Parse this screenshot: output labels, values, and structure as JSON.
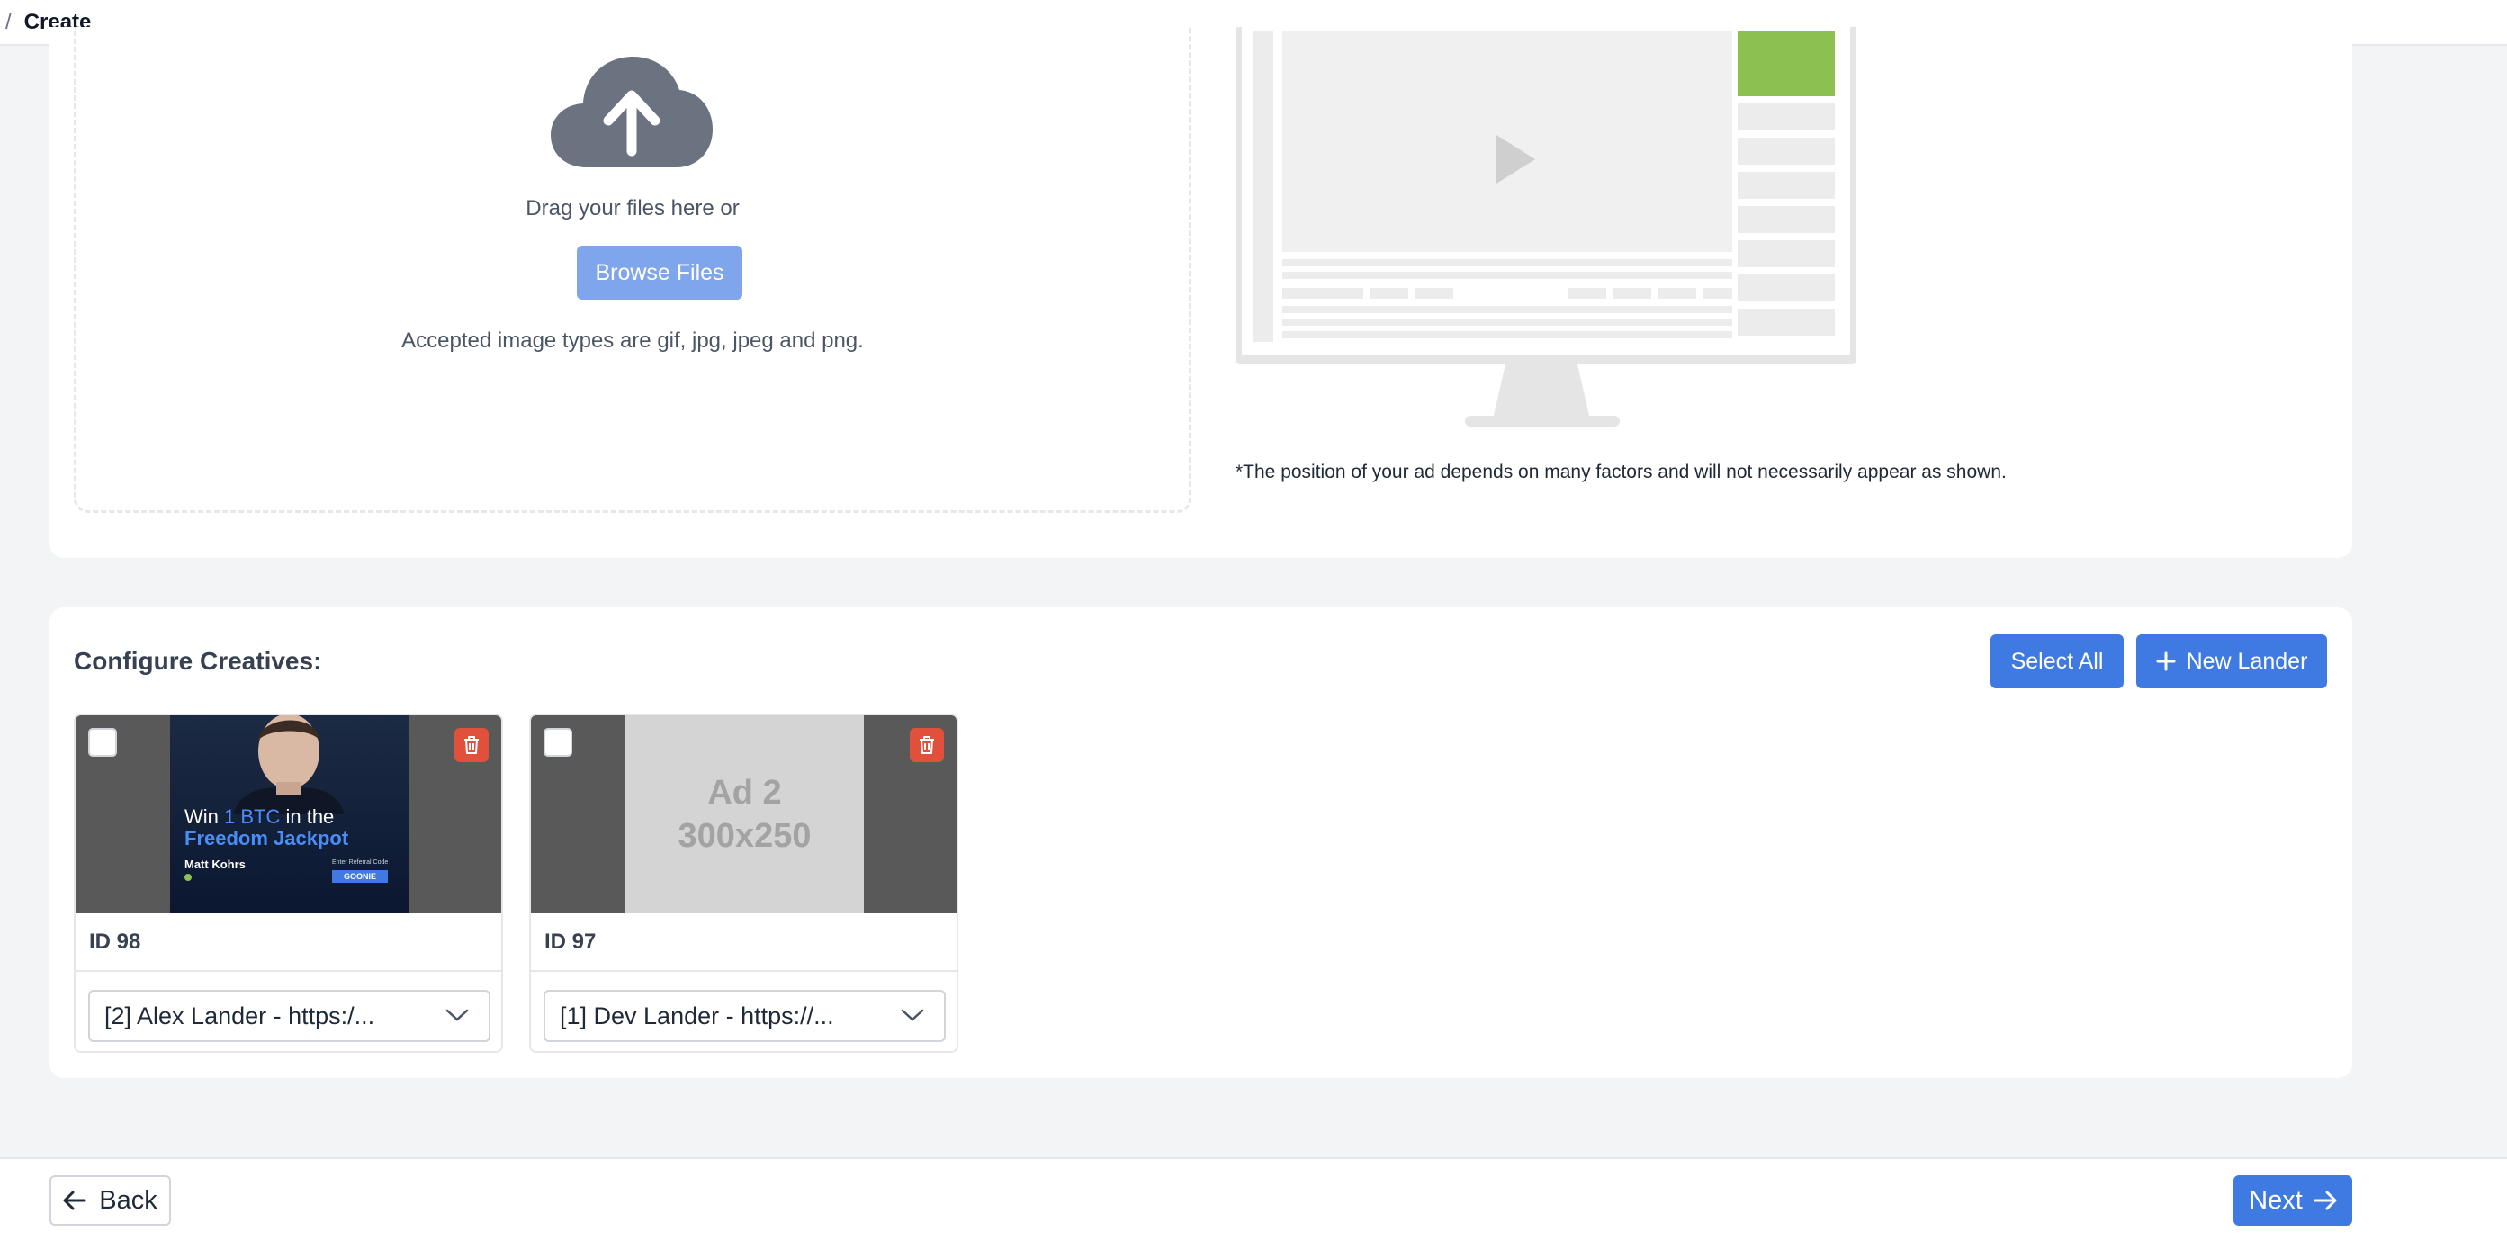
{
  "breadcrumb": {
    "separator": "/",
    "current": "Create"
  },
  "upload": {
    "drag_text": "Drag your files here or",
    "browse_label": "Browse Files",
    "accepted_text": "Accepted image types are gif, jpg, jpeg and png.",
    "icon": "cloud-upload-icon"
  },
  "preview": {
    "disclaimer": "*The position of your ad depends on many factors and will not necessarily appear as shown.",
    "highlight_color": "#8cc152"
  },
  "configure": {
    "title": "Configure Creatives:",
    "select_all_label": "Select All",
    "new_lander_label": "New Lander",
    "creatives": [
      {
        "id_label": "ID 98",
        "lander": "[2] Alex Lander - https:/...",
        "banner": {
          "line1_prefix": "Win ",
          "line1_highlight": "1 BTC",
          "line1_suffix": " in the",
          "line2": "Freedom Jackpot",
          "name": "Matt Kohrs",
          "referral_label": "Enter Referral Code",
          "code": "GOONIE"
        }
      },
      {
        "id_label": "ID 97",
        "lander": "[1] Dev Lander - https://...",
        "placeholder_line1": "Ad 2",
        "placeholder_line2": "300x250"
      }
    ]
  },
  "footer": {
    "back_label": "Back",
    "next_label": "Next"
  },
  "colors": {
    "primary": "#3f7ae3",
    "primary_light": "#7fa6ec",
    "danger": "#e0503b"
  }
}
